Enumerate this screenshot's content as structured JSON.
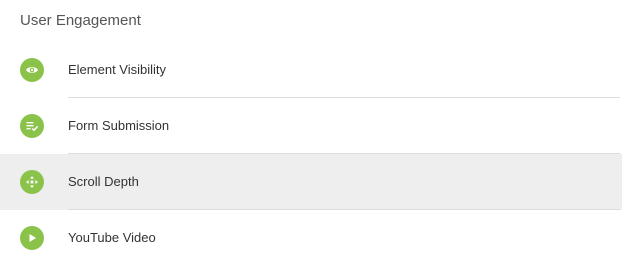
{
  "section": {
    "title": "User Engagement"
  },
  "accent_color": "#8bc34a",
  "items": [
    {
      "label": "Element Visibility",
      "icon": "eye-icon"
    },
    {
      "label": "Form Submission",
      "icon": "form-check-icon"
    },
    {
      "label": "Scroll Depth",
      "icon": "arrows-move-icon",
      "selected": true
    },
    {
      "label": "YouTube Video",
      "icon": "play-icon"
    }
  ]
}
